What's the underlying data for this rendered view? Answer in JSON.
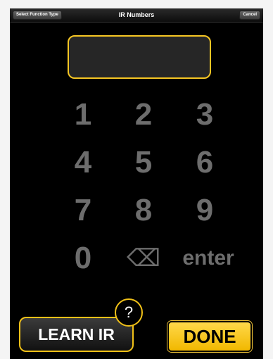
{
  "navbar": {
    "left_button": "Select Function Type",
    "title": "IR Numbers",
    "right_button": "Cancel"
  },
  "display": {
    "value": ""
  },
  "keypad": {
    "k1": "1",
    "k2": "2",
    "k3": "3",
    "k4": "4",
    "k5": "5",
    "k6": "6",
    "k7": "7",
    "k8": "8",
    "k9": "9",
    "k0": "0",
    "backspace_icon": "backspace-icon",
    "backspace_glyph": "⌫",
    "enter": "enter"
  },
  "bottom": {
    "learn_ir": "LEARN IR",
    "help": "?",
    "done": "DONE"
  },
  "colors": {
    "accent": "#f6c623",
    "key_text": "#6d6d6d",
    "background": "#000000"
  }
}
